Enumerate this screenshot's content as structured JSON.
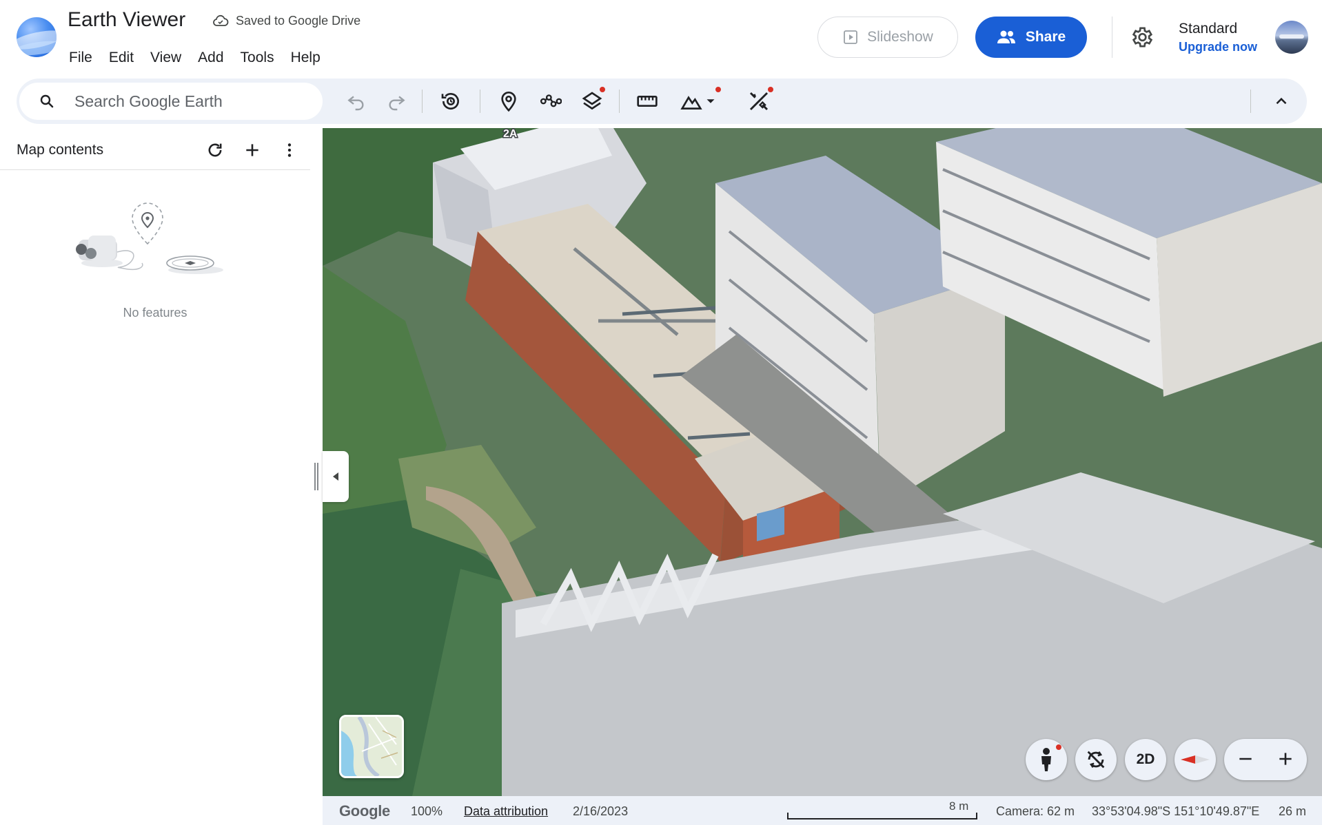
{
  "header": {
    "app_title": "Earth Viewer",
    "save_status": "Saved to Google Drive",
    "menu": [
      "File",
      "Edit",
      "View",
      "Add",
      "Tools",
      "Help"
    ],
    "slideshow_label": "Slideshow",
    "share_label": "Share",
    "plan_name": "Standard",
    "upgrade_label": "Upgrade now"
  },
  "toolbar": {
    "search_placeholder": "Search Google Earth",
    "tools": [
      "undo-icon",
      "redo-icon",
      "history-icon",
      "placemark-icon",
      "path-icon",
      "layers-icon",
      "ruler-icon",
      "terrain-icon",
      "tools-icon",
      "collapse-chevron-icon"
    ]
  },
  "sidebar": {
    "title": "Map contents",
    "empty_text": "No features"
  },
  "map": {
    "building_label": "2A",
    "controls": {
      "view_mode_label": "2D"
    }
  },
  "statusbar": {
    "brand": "Google",
    "zoom": "100%",
    "attribution": "Data attribution",
    "date": "2/16/2023",
    "scale_label": "8 m",
    "camera": "Camera: 62 m",
    "coordinates": "33°53'04.98\"S 151°10'49.87\"E",
    "altitude": "26 m"
  },
  "colors": {
    "accent": "#1a5fd6",
    "toolbar_bg": "#edf1f8",
    "notification_dot": "#d93025"
  }
}
